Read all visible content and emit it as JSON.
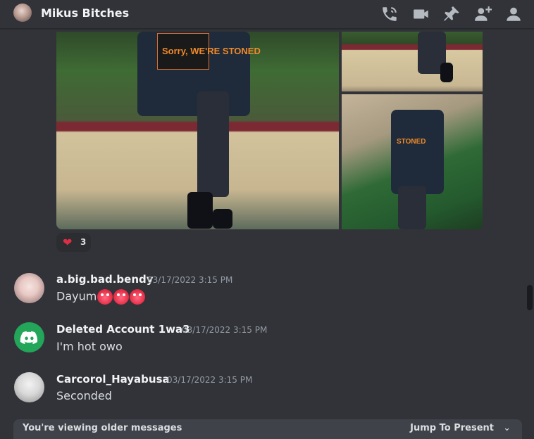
{
  "header": {
    "title": "Mikus Bitches",
    "icons": [
      "threads-call-icon",
      "video-icon",
      "pin-icon",
      "add-member-icon",
      "member-list-icon"
    ]
  },
  "attachment": {
    "main_patch_text": "Sorry, WE'RE STONED",
    "side_patch_text": "STONED"
  },
  "reaction": {
    "emoji": "❤",
    "count": "3"
  },
  "messages": [
    {
      "username": "a.big.bad.bendy",
      "timestamp": "03/17/2022 3:15 PM",
      "content": "Dayum"
    },
    {
      "username": "Deleted Account 1wa3",
      "timestamp": "03/17/2022 3:15 PM",
      "content": "I'm hot owo"
    },
    {
      "username": "Carcorol_Hayabusa",
      "timestamp": "03/17/2022 3:15 PM",
      "content": "Seconded"
    }
  ],
  "older_bar": {
    "text": "You're viewing older messages",
    "jump_label": "Jump To Present",
    "chevron": "⌄"
  },
  "colors": {
    "background": "#313338",
    "header_text": "#f2f3f5",
    "timestamp": "#949ba4",
    "reaction_heart": "#dd2e44"
  }
}
